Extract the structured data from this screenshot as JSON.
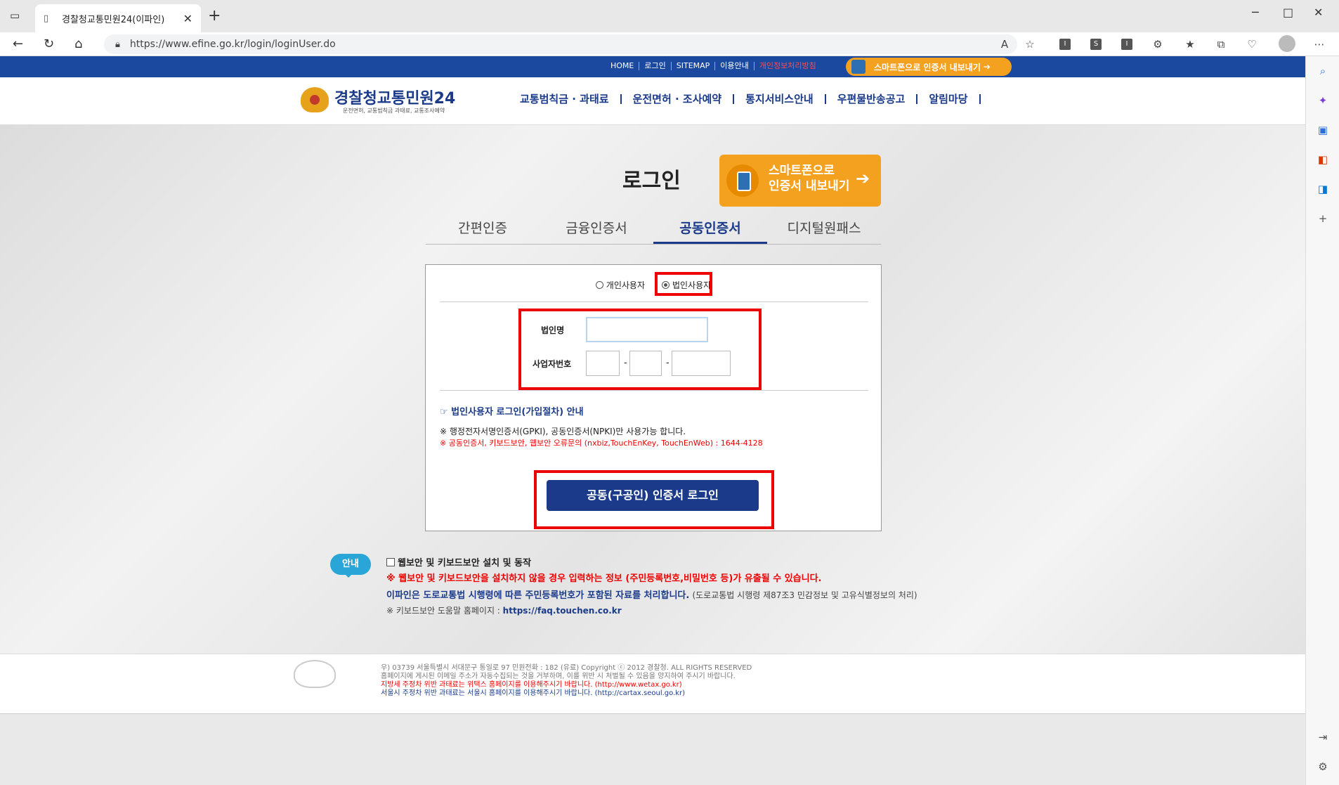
{
  "browser": {
    "tab_title": "경찰청교통민원24(이파인)",
    "url": "https://www.efine.go.kr/login/loginUser.do"
  },
  "topbar": {
    "links": [
      "HOME",
      "로그인",
      "SITEMAP",
      "이용안내"
    ],
    "privacy_link": "개인정보처리방침",
    "phone_export": "스마트폰으로 인증서 내보내기"
  },
  "header": {
    "logo_text": "경찰청교통민원24",
    "logo_sub": "운전면허, 교통범칙금 과태료, 교통조사예약",
    "nav": [
      "교통범칙금 · 과태료",
      "운전면허 · 조사예약",
      "통지서비스안내",
      "우편물반송공고",
      "알림마당"
    ]
  },
  "login": {
    "title": "로그인",
    "phone_export_line1": "스마트폰으로",
    "phone_export_line2": "인증서 내보내기",
    "tabs": [
      "간편인증",
      "금융인증서",
      "공동인증서",
      "디지털원패스"
    ],
    "active_tab": "공동인증서",
    "radio_personal": "개인사용자",
    "radio_corporate": "법인사용자",
    "selected_radio": "법인사용자",
    "label_corp_name": "법인명",
    "label_biz_no": "사업자번호",
    "corp_name_value": "",
    "biz_no_1": "",
    "biz_no_2": "",
    "biz_no_3": "",
    "dash": "-",
    "info_link": "☞ 법인사용자 로그인(가입절차) 안내",
    "note1": "※ 행정전자서명인증서(GPKI), 공동인증서(NPKI)만 사용가능 합니다.",
    "note2": "※ 공동인증서, 키보드보안, 웹보안 오류문의 (nxbiz,TouchEnKey, TouchEnWeb) : 1644-4128",
    "login_button": "공동(구공인) 인증서 로그인"
  },
  "guide": {
    "badge": "안내",
    "checkbox_label": "웹보안 및 키보드보안 설치 및 동작",
    "warning": "※ 웹보안 및 키보드보안을 설치하지 않을 경우 입력하는 정보 (주민등록번호,비밀번호 등)가 유출될 수 있습니다.",
    "notice_bold": "이파인은 도로교통법 시행령에 따른 주민등록번호가 포함된 자료를 처리합니다.",
    "notice_sub": "(도로교통법 시행령 제87조3 민감정보 및 고유식별정보의 처리)",
    "help_prefix": "※ 키보드보안 도움말 홈페이지 :",
    "help_url": "https://faq.touchen.co.kr"
  },
  "footer": {
    "line1": "우) 03739 서울특별시 서대문구 통일로 97  민원전화 : 182 (유료)        Copyright ⓒ 2012 경찰청. ALL RIGHTS RESERVED",
    "line2": "홈페이지에 게시된 이메일 주소가 자동수집되는 것을 거부하며, 이를 위반 시 처벌될 수 있음을 양지하여 주시기 바랍니다.",
    "line3": "지방세 주정차 위반 과태료는 위택스 홈페이지를 이용해주시기 바랍니다. (http://www.wetax.go.kr)",
    "line4": "서울시 주정차 위반 과태료는 서울시 홈페이지를 이용해주시기 바랍니다. (http://cartax.seoul.go.kr)"
  }
}
